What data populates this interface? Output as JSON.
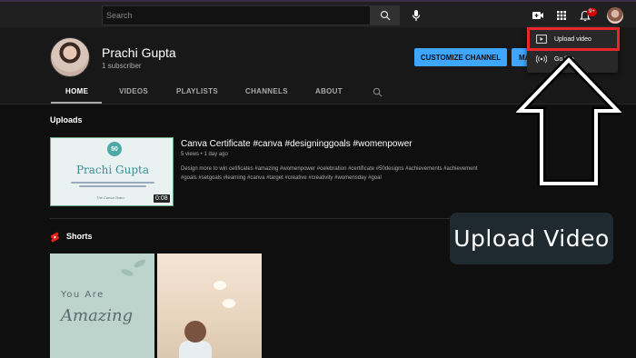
{
  "topbar": {
    "search_placeholder": "Search",
    "notification_count": "9+",
    "icons": [
      "search-icon",
      "mic-icon",
      "create-video-icon",
      "apps-grid-icon",
      "bell-icon"
    ]
  },
  "channel": {
    "name": "Prachi Gupta",
    "subscribers": "1 subscriber",
    "customize_label": "CUSTOMIZE CHANNEL",
    "manage_label": "MANAGE VIDEOS"
  },
  "tabs": [
    {
      "label": "HOME",
      "active": true
    },
    {
      "label": "VIDEOS"
    },
    {
      "label": "PLAYLISTS"
    },
    {
      "label": "CHANNELS"
    },
    {
      "label": "ABOUT"
    }
  ],
  "uploads": {
    "section_title": "Uploads",
    "video": {
      "title": "Canva Certificate #canva #designinggoals #womenpower",
      "meta": "5 views • 1 day ago",
      "description": "Design more to win cetificates #amazing #womenpower #celebration #certificate #50designs #achievements #achievement #goals #setgoals #learning #canva #target #creative #creativity #womensday #goal",
      "duration": "0:08",
      "thumbnail": {
        "badge": "50",
        "name": "Prachi Gupta",
        "sign": "The Canva Team"
      }
    }
  },
  "shorts": {
    "section_title": "Shorts",
    "items": [
      {
        "line1": "You Are",
        "line2": "Amazing"
      },
      {}
    ]
  },
  "create_menu": {
    "items": [
      {
        "label": "Upload video",
        "icon": "play-box-icon"
      },
      {
        "label": "Go live",
        "icon": "live-icon"
      }
    ]
  },
  "annotation": {
    "callout_text": "Upload Video",
    "highlight_color": "#e8262b",
    "arrow_color": "#ffffff"
  },
  "colors": {
    "accent": "#3ea6ff",
    "background": "#0f0f0f",
    "header_bg": "#202020"
  }
}
